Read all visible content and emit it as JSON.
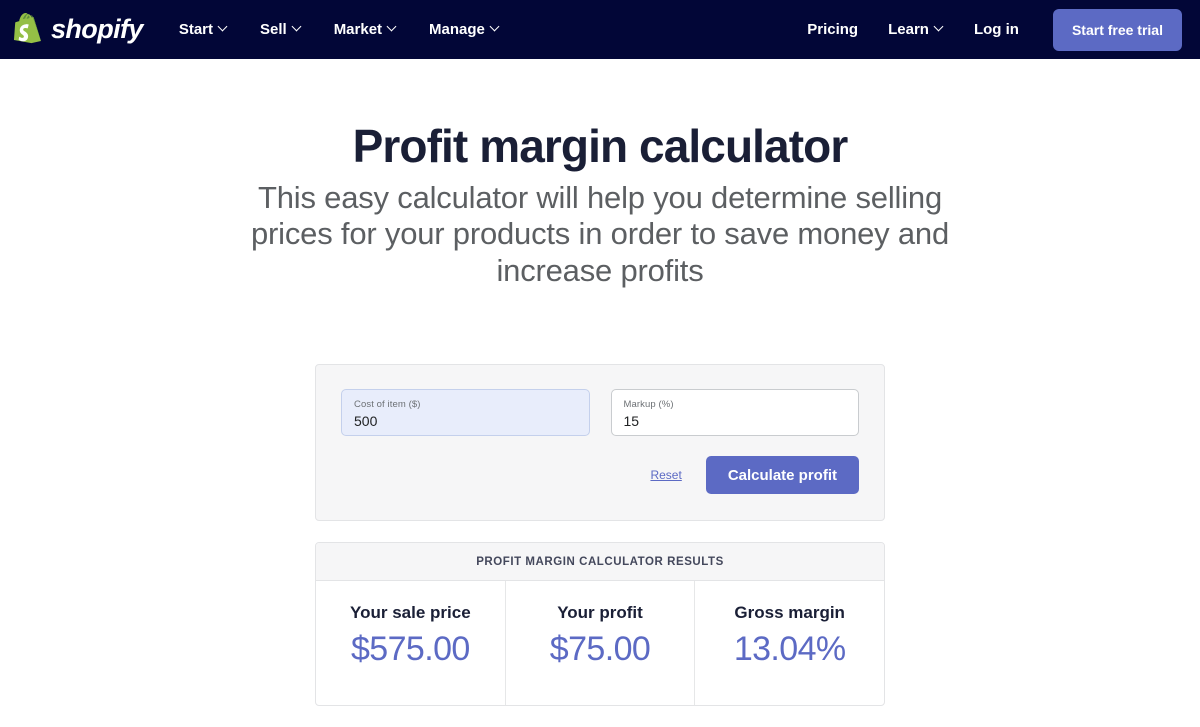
{
  "navbar": {
    "brand": {
      "name": "shopify",
      "logo_icon": "shopify-bag-icon",
      "logo_color": "#95bf46"
    },
    "background_color": "#020637",
    "menu": [
      {
        "label": "Start",
        "has_dropdown": true
      },
      {
        "label": "Sell",
        "has_dropdown": true
      },
      {
        "label": "Market",
        "has_dropdown": true
      },
      {
        "label": "Manage",
        "has_dropdown": true
      }
    ],
    "right_links": [
      {
        "label": "Pricing",
        "has_dropdown": false
      },
      {
        "label": "Learn",
        "has_dropdown": true
      },
      {
        "label": "Log in",
        "has_dropdown": false
      }
    ],
    "cta": {
      "label": "Start free trial",
      "color": "#5c6ac4"
    }
  },
  "hero": {
    "title": "Profit margin calculator",
    "subtitle": "This easy calculator will help you determine selling prices for your products in order to save money and increase profits"
  },
  "calculator": {
    "fields": [
      {
        "label": "Cost of item ($)",
        "value": "500",
        "placeholder": "",
        "focused": true
      },
      {
        "label": "Markup (%)",
        "value": "15",
        "placeholder": "",
        "focused": false
      }
    ],
    "reset_label": "Reset",
    "submit_label": "Calculate profit",
    "accent_color": "#5c6ac4"
  },
  "results": {
    "header": "PROFIT MARGIN CALCULATOR RESULTS",
    "cells": [
      {
        "label": "Your sale price",
        "value": "$575.00"
      },
      {
        "label": "Your profit",
        "value": "$75.00"
      },
      {
        "label": "Gross margin",
        "value": "13.04%"
      }
    ]
  }
}
